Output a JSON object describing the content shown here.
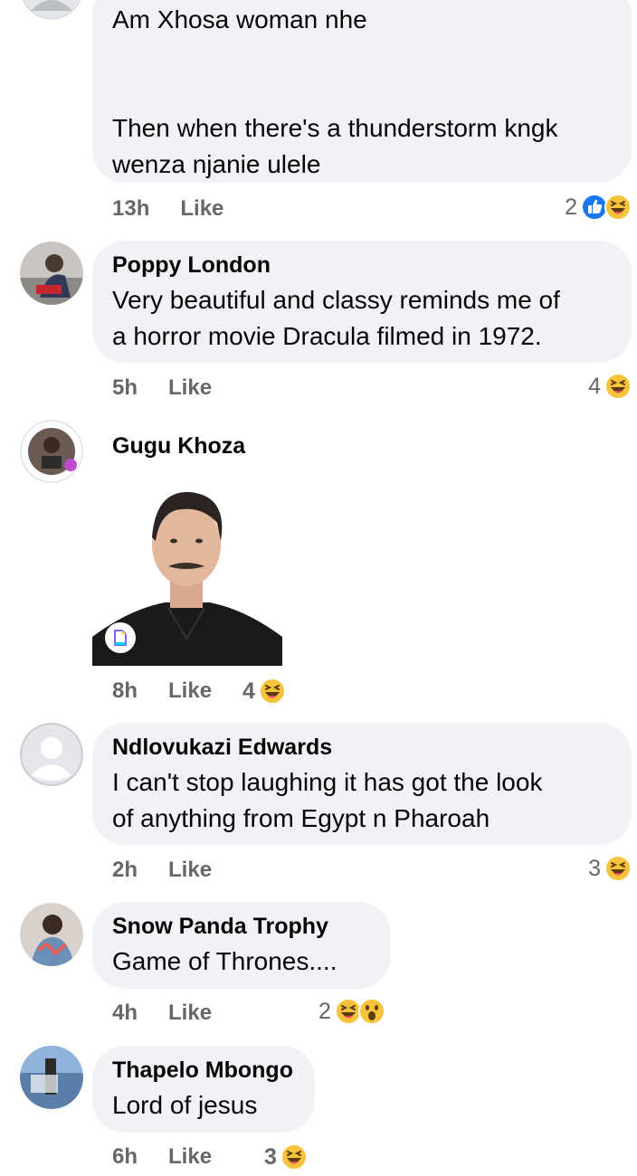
{
  "comments": [
    {
      "author": "",
      "text": "Am Xhosa woman nhe\n\n\nThen when there's a thunderstorm kngk\nwenza njanie ulele",
      "time": "13h",
      "like_label": "Like",
      "reaction_count": "2",
      "reactions": [
        "like-emoji",
        "laugh-emoji"
      ]
    },
    {
      "author": "Poppy London",
      "text": "Very beautiful and classy reminds me of\na horror movie Dracula filmed in 1972.",
      "time": "5h",
      "like_label": "Like",
      "reaction_count": "4",
      "reactions": [
        "laugh-emoji"
      ]
    },
    {
      "author": "Gugu Khoza",
      "attachment": "gif",
      "time": "8h",
      "like_label": "Like",
      "reaction_count": "4",
      "reactions": [
        "laugh-emoji"
      ]
    },
    {
      "author": "Ndlovukazi Edwards",
      "text": "I can't stop laughing it has got the look\nof anything from Egypt n Pharoah",
      "time": "2h",
      "like_label": "Like",
      "reaction_count": "3",
      "reactions": [
        "laugh-emoji"
      ]
    },
    {
      "author": "Snow Panda Trophy",
      "text": "Game of Thrones....",
      "time": "4h",
      "like_label": "Like",
      "reaction_count": "2",
      "reactions": [
        "laugh-emoji",
        "wow-emoji"
      ]
    },
    {
      "author": "Thapelo Mbongo",
      "text": "Lord of jesus",
      "time": "6h",
      "like_label": "Like",
      "reaction_count": "3",
      "reactions": [
        "laugh-emoji"
      ]
    }
  ],
  "colors": {
    "bubble": "#f0f2f5",
    "meta_text": "#65676b",
    "like_blue": "#1877f2",
    "emoji_yellow": "#f7c33b"
  }
}
